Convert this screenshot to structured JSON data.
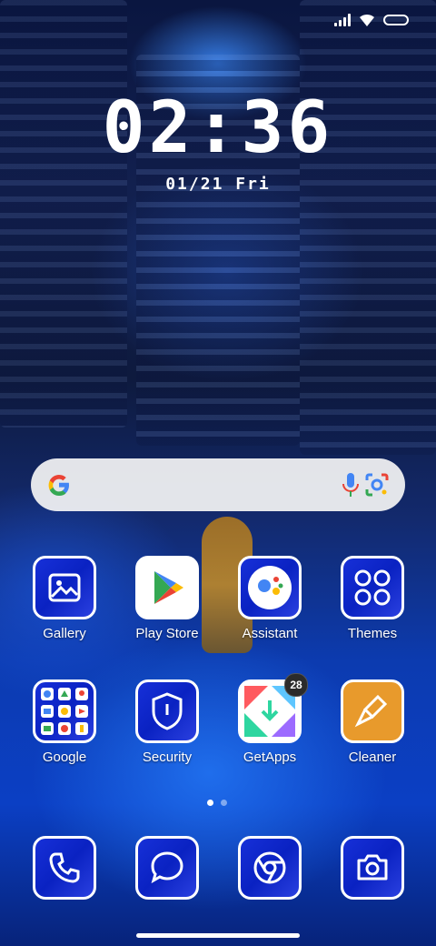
{
  "clock": {
    "time": "02:36",
    "date": "01/21 Fri"
  },
  "search": {
    "provider": "Google",
    "mic_icon": "microphone-icon",
    "lens_icon": "lens-icon"
  },
  "apps": {
    "row1": [
      {
        "label": "Gallery",
        "icon": "gallery-icon"
      },
      {
        "label": "Play Store",
        "icon": "play-store-icon"
      },
      {
        "label": "Assistant",
        "icon": "assistant-icon"
      },
      {
        "label": "Themes",
        "icon": "themes-icon"
      }
    ],
    "row2": [
      {
        "label": "Google",
        "icon": "google-folder-icon"
      },
      {
        "label": "Security",
        "icon": "security-icon"
      },
      {
        "label": "GetApps",
        "icon": "getapps-icon",
        "badge": "28"
      },
      {
        "label": "Cleaner",
        "icon": "cleaner-icon"
      }
    ]
  },
  "dock": [
    {
      "icon": "phone-icon"
    },
    {
      "icon": "messages-icon"
    },
    {
      "icon": "chrome-icon"
    },
    {
      "icon": "camera-icon"
    }
  ],
  "pager": {
    "pages": 2,
    "current": 1
  },
  "colors": {
    "icon_fill": "#0a22c2",
    "getapps_badge": "#2b2b2b",
    "cleaner_bg": "#e89a2c"
  }
}
